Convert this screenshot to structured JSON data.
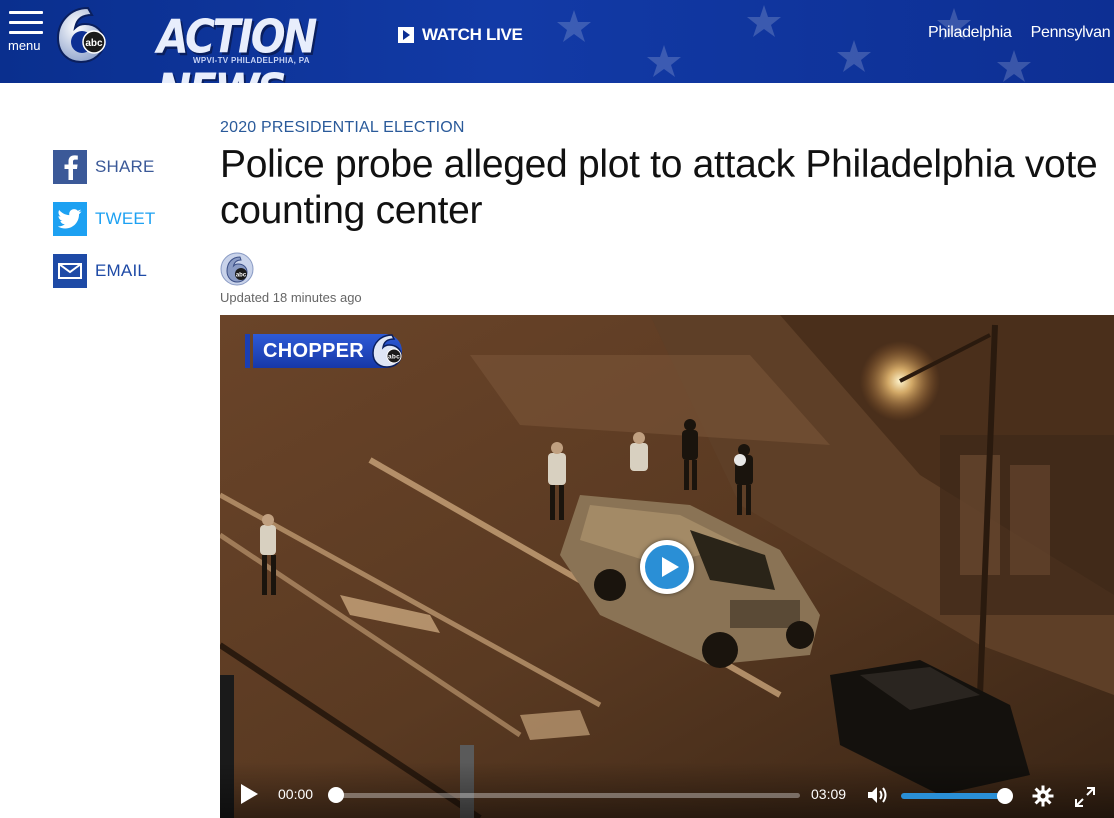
{
  "header": {
    "menu_label": "menu",
    "logo_text": "ACTION NEWS",
    "logo_sub": "WPVI-TV  PHILADELPHIA, PA",
    "logo_badge": "abc",
    "watch_live_label": "WATCH LIVE",
    "nav_links": [
      "Philadelphia",
      "Pennsylvan"
    ],
    "bg_color": "#0d2f93"
  },
  "share": {
    "facebook_label": "SHARE",
    "twitter_label": "TWEET",
    "email_label": "EMAIL",
    "facebook_color": "#3b5998",
    "twitter_color": "#1da1f2",
    "email_color": "#1e4aa6"
  },
  "article": {
    "category": "2020 PRESIDENTIAL ELECTION",
    "headline": "Police probe alleged plot to attack Philadelphia vote counting center",
    "updated": "Updated 18 minutes ago",
    "author_badge": "abc"
  },
  "video": {
    "bug_label": "CHOPPER",
    "bug_badge": "abc",
    "current_time": "00:00",
    "duration": "03:09",
    "progress": 0.0,
    "volume": 1.0,
    "accent_color": "#2a8fd6"
  }
}
